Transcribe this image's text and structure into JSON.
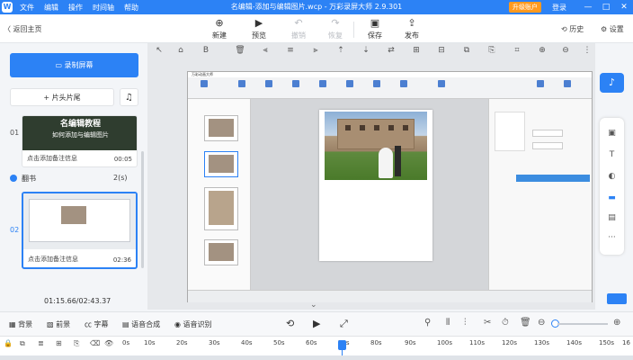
{
  "window": {
    "title": "名编辑-添加与编辑图片.wcp - 万彩录屏大师 2.9.301",
    "upgrade": "升级账户",
    "login": "登录",
    "minimize": "—",
    "maximize": "□",
    "close": "✕"
  },
  "menu": [
    "文件",
    "编辑",
    "操作",
    "时间轴",
    "帮助"
  ],
  "toolbar": {
    "back": "返回主页",
    "new": "新建",
    "preview": "预览",
    "undo": "撤销",
    "redo": "恢复",
    "save": "保存",
    "publish": "发布",
    "history": "历史",
    "settings": "设置"
  },
  "left": {
    "record": "录制屏幕",
    "head_tail": "片头片尾",
    "scenes": [
      {
        "num": "01",
        "thumb_title": "名编辑教程",
        "thumb_sub": "如何添加与编辑图片",
        "note": "点击添加备注信息",
        "duration": "00:05"
      },
      {
        "num": "02",
        "note": "点击添加备注信息",
        "duration": "02:36"
      }
    ],
    "subtitle": {
      "label": "翻书",
      "count": "2(s)"
    },
    "time": "01:15.66/02:43.37"
  },
  "stage": {
    "app_title": "万彩动画大师"
  },
  "timeline": {
    "tracks": [
      "背景",
      "前景",
      "字幕",
      "语音合成",
      "语音识别"
    ],
    "ticks": [
      "0s",
      "10s",
      "20s",
      "30s",
      "40s",
      "50s",
      "60s",
      "70s",
      "80s",
      "90s",
      "100s",
      "110s",
      "120s",
      "130s",
      "140s",
      "150s",
      "16"
    ]
  },
  "colors": {
    "accent": "#2c82f5",
    "upgrade": "#ff9a1f"
  }
}
